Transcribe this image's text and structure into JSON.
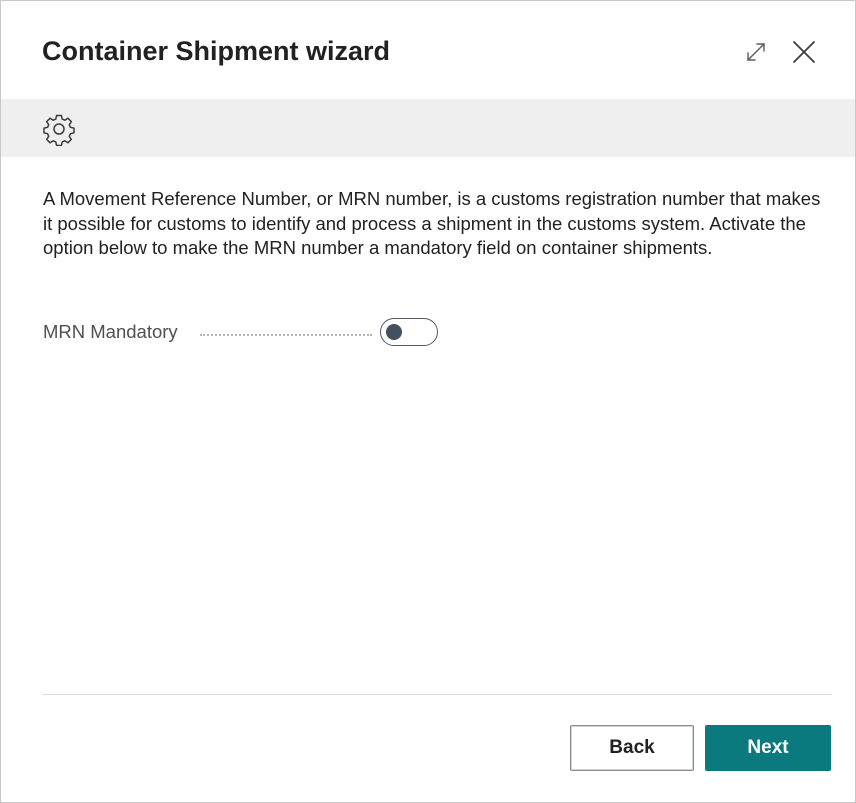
{
  "dialog": {
    "title": "Container Shipment wizard",
    "expand_icon": "expand-diagonal-arrows",
    "close_icon": "close-x"
  },
  "toolbar": {
    "settings_icon": "gear"
  },
  "content": {
    "description": "A Movement Reference Number, or MRN number, is a customs registration number that makes it possible for customs to identify and process a shipment in the customs system. Activate the option below to make the MRN number a mandatory field on container shipments.",
    "fields": [
      {
        "label": "MRN Mandatory",
        "type": "toggle",
        "value": false
      }
    ]
  },
  "footer": {
    "back_label": "Back",
    "next_label": "Next"
  },
  "colors": {
    "accent": "#0b7a7f",
    "toolbar_bg": "#efefef",
    "text": "#212121"
  }
}
